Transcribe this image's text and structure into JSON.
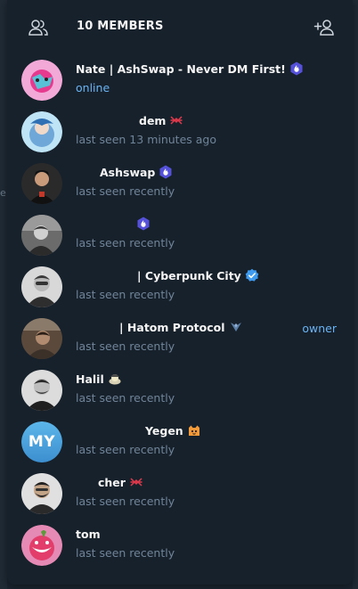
{
  "header": {
    "title": "10 MEMBERS",
    "left_icon": "members-icon",
    "right_icon": "add-member-icon"
  },
  "colors": {
    "panel_bg": "#17212b",
    "name_text": "#f5f5f5",
    "status_text": "#708499",
    "accent": "#6ab3f3"
  },
  "members": [
    {
      "name": "Nate | AshSwap - Never DM First!",
      "status": "online",
      "badge": "hexagon-flame-icon"
    },
    {
      "name": "dem",
      "status": "last seen 13 minutes ago",
      "badge": "logo-icon"
    },
    {
      "name": "Ashswap",
      "status": "last seen recently",
      "badge": "hexagon-flame-icon"
    },
    {
      "name": "",
      "status": "last seen recently",
      "badge": "hexagon-flame-icon"
    },
    {
      "name": "| Cyberpunk City",
      "status": "last seen recently",
      "badge": "verified-icon"
    },
    {
      "name": "| Hatom Protocol",
      "status": "last seen recently",
      "badge": "wings-icon",
      "role": "owner"
    },
    {
      "name": "Halil",
      "status": "last seen recently",
      "badge": "emoji-icon"
    },
    {
      "name": "Yegen",
      "status": "last seen recently",
      "badge": "cat-emoji-icon",
      "initials": "MY"
    },
    {
      "name": "cher",
      "status": "last seen recently",
      "badge": "logo-icon"
    },
    {
      "name": "tom",
      "status": "last seen recently"
    }
  ]
}
